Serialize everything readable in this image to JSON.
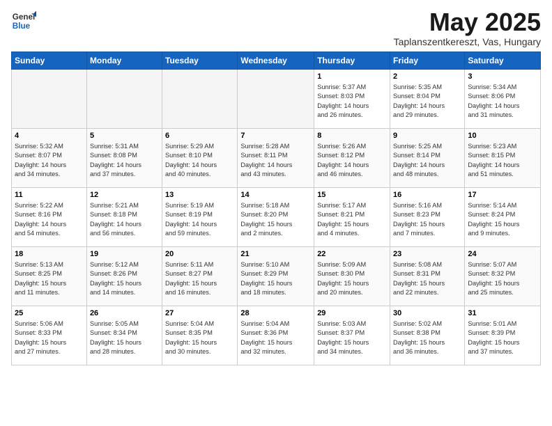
{
  "logo": {
    "line1": "General",
    "line2": "Blue"
  },
  "title": "May 2025",
  "subtitle": "Taplanszentkereszt, Vas, Hungary",
  "weekdays": [
    "Sunday",
    "Monday",
    "Tuesday",
    "Wednesday",
    "Thursday",
    "Friday",
    "Saturday"
  ],
  "weeks": [
    [
      {
        "day": "",
        "info": ""
      },
      {
        "day": "",
        "info": ""
      },
      {
        "day": "",
        "info": ""
      },
      {
        "day": "",
        "info": ""
      },
      {
        "day": "1",
        "info": "Sunrise: 5:37 AM\nSunset: 8:03 PM\nDaylight: 14 hours\nand 26 minutes."
      },
      {
        "day": "2",
        "info": "Sunrise: 5:35 AM\nSunset: 8:04 PM\nDaylight: 14 hours\nand 29 minutes."
      },
      {
        "day": "3",
        "info": "Sunrise: 5:34 AM\nSunset: 8:06 PM\nDaylight: 14 hours\nand 31 minutes."
      }
    ],
    [
      {
        "day": "4",
        "info": "Sunrise: 5:32 AM\nSunset: 8:07 PM\nDaylight: 14 hours\nand 34 minutes."
      },
      {
        "day": "5",
        "info": "Sunrise: 5:31 AM\nSunset: 8:08 PM\nDaylight: 14 hours\nand 37 minutes."
      },
      {
        "day": "6",
        "info": "Sunrise: 5:29 AM\nSunset: 8:10 PM\nDaylight: 14 hours\nand 40 minutes."
      },
      {
        "day": "7",
        "info": "Sunrise: 5:28 AM\nSunset: 8:11 PM\nDaylight: 14 hours\nand 43 minutes."
      },
      {
        "day": "8",
        "info": "Sunrise: 5:26 AM\nSunset: 8:12 PM\nDaylight: 14 hours\nand 46 minutes."
      },
      {
        "day": "9",
        "info": "Sunrise: 5:25 AM\nSunset: 8:14 PM\nDaylight: 14 hours\nand 48 minutes."
      },
      {
        "day": "10",
        "info": "Sunrise: 5:23 AM\nSunset: 8:15 PM\nDaylight: 14 hours\nand 51 minutes."
      }
    ],
    [
      {
        "day": "11",
        "info": "Sunrise: 5:22 AM\nSunset: 8:16 PM\nDaylight: 14 hours\nand 54 minutes."
      },
      {
        "day": "12",
        "info": "Sunrise: 5:21 AM\nSunset: 8:18 PM\nDaylight: 14 hours\nand 56 minutes."
      },
      {
        "day": "13",
        "info": "Sunrise: 5:19 AM\nSunset: 8:19 PM\nDaylight: 14 hours\nand 59 minutes."
      },
      {
        "day": "14",
        "info": "Sunrise: 5:18 AM\nSunset: 8:20 PM\nDaylight: 15 hours\nand 2 minutes."
      },
      {
        "day": "15",
        "info": "Sunrise: 5:17 AM\nSunset: 8:21 PM\nDaylight: 15 hours\nand 4 minutes."
      },
      {
        "day": "16",
        "info": "Sunrise: 5:16 AM\nSunset: 8:23 PM\nDaylight: 15 hours\nand 7 minutes."
      },
      {
        "day": "17",
        "info": "Sunrise: 5:14 AM\nSunset: 8:24 PM\nDaylight: 15 hours\nand 9 minutes."
      }
    ],
    [
      {
        "day": "18",
        "info": "Sunrise: 5:13 AM\nSunset: 8:25 PM\nDaylight: 15 hours\nand 11 minutes."
      },
      {
        "day": "19",
        "info": "Sunrise: 5:12 AM\nSunset: 8:26 PM\nDaylight: 15 hours\nand 14 minutes."
      },
      {
        "day": "20",
        "info": "Sunrise: 5:11 AM\nSunset: 8:27 PM\nDaylight: 15 hours\nand 16 minutes."
      },
      {
        "day": "21",
        "info": "Sunrise: 5:10 AM\nSunset: 8:29 PM\nDaylight: 15 hours\nand 18 minutes."
      },
      {
        "day": "22",
        "info": "Sunrise: 5:09 AM\nSunset: 8:30 PM\nDaylight: 15 hours\nand 20 minutes."
      },
      {
        "day": "23",
        "info": "Sunrise: 5:08 AM\nSunset: 8:31 PM\nDaylight: 15 hours\nand 22 minutes."
      },
      {
        "day": "24",
        "info": "Sunrise: 5:07 AM\nSunset: 8:32 PM\nDaylight: 15 hours\nand 25 minutes."
      }
    ],
    [
      {
        "day": "25",
        "info": "Sunrise: 5:06 AM\nSunset: 8:33 PM\nDaylight: 15 hours\nand 27 minutes."
      },
      {
        "day": "26",
        "info": "Sunrise: 5:05 AM\nSunset: 8:34 PM\nDaylight: 15 hours\nand 28 minutes."
      },
      {
        "day": "27",
        "info": "Sunrise: 5:04 AM\nSunset: 8:35 PM\nDaylight: 15 hours\nand 30 minutes."
      },
      {
        "day": "28",
        "info": "Sunrise: 5:04 AM\nSunset: 8:36 PM\nDaylight: 15 hours\nand 32 minutes."
      },
      {
        "day": "29",
        "info": "Sunrise: 5:03 AM\nSunset: 8:37 PM\nDaylight: 15 hours\nand 34 minutes."
      },
      {
        "day": "30",
        "info": "Sunrise: 5:02 AM\nSunset: 8:38 PM\nDaylight: 15 hours\nand 36 minutes."
      },
      {
        "day": "31",
        "info": "Sunrise: 5:01 AM\nSunset: 8:39 PM\nDaylight: 15 hours\nand 37 minutes."
      }
    ]
  ]
}
